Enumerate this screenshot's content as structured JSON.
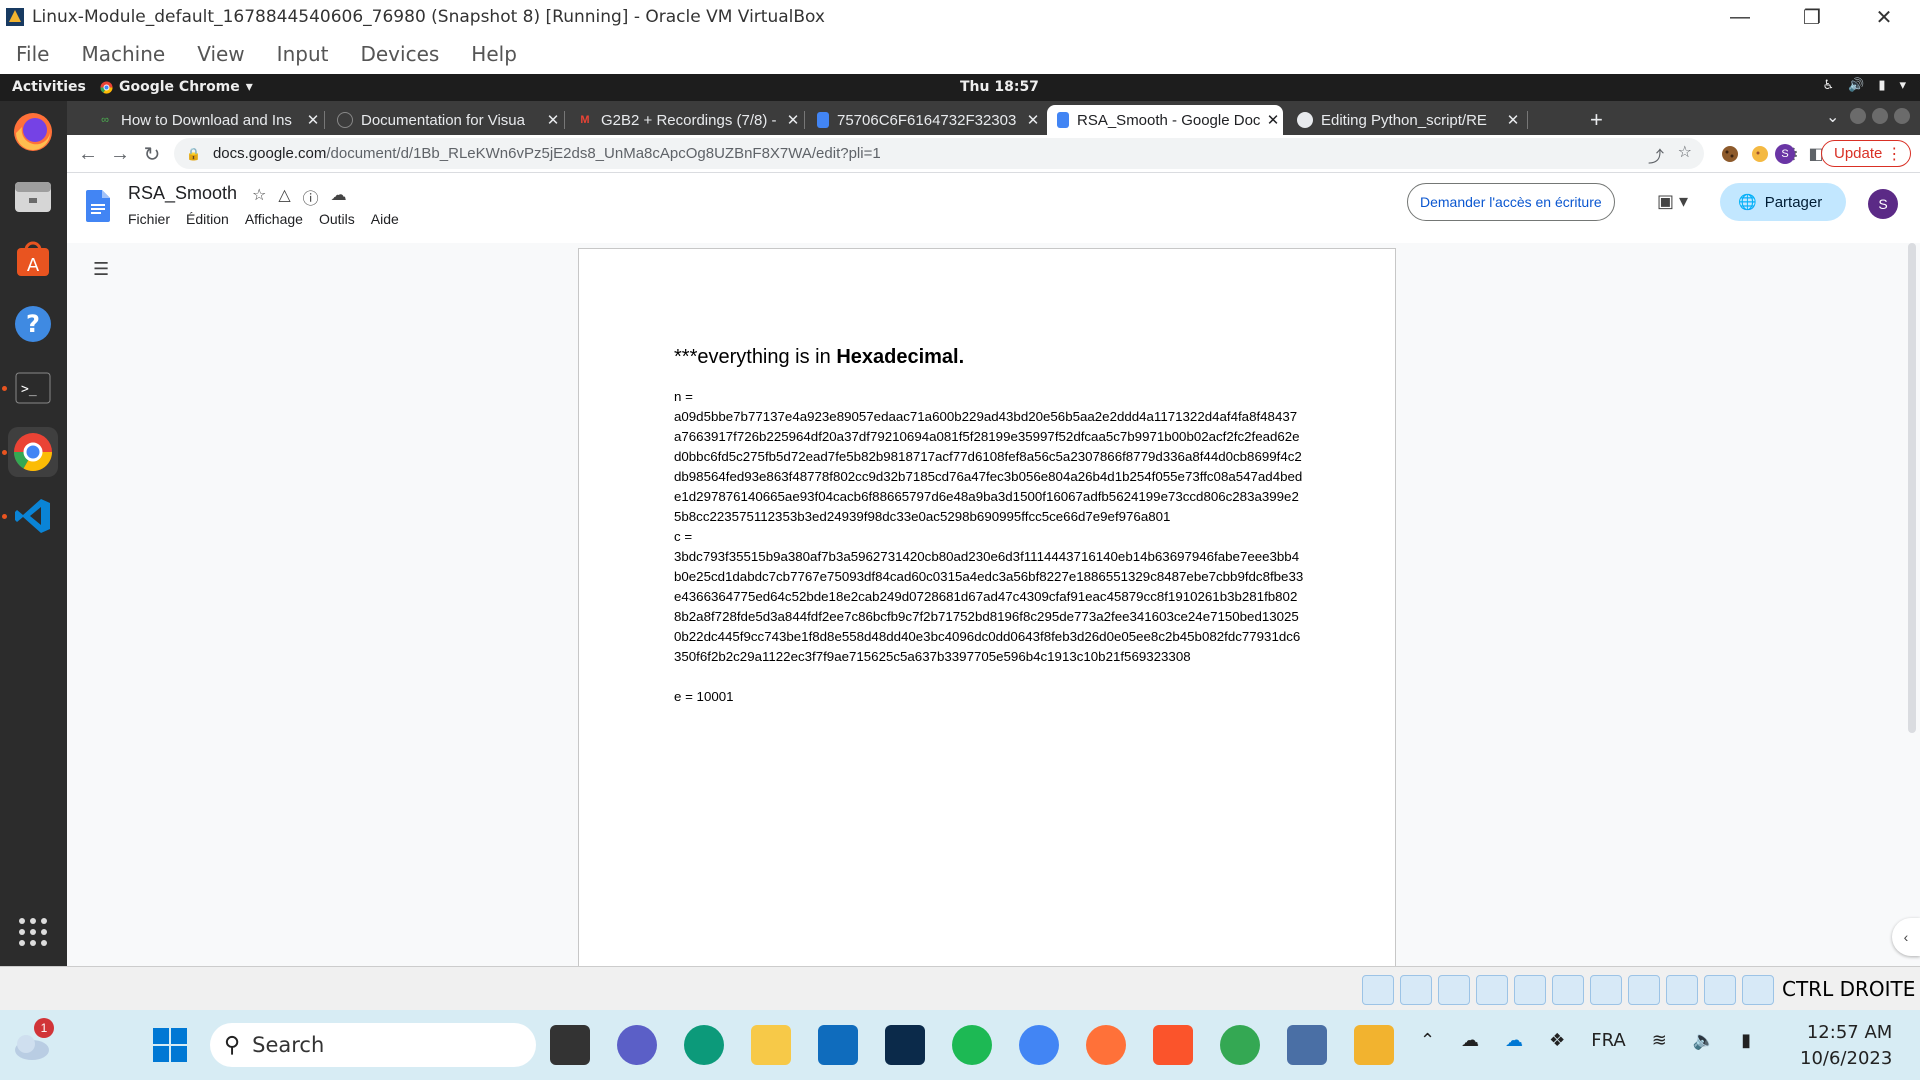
{
  "vbox": {
    "window_title": "Linux-Module_default_1678844540606_76980 (Snapshot 8) [Running] - Oracle VM VirtualBox",
    "menu": [
      "File",
      "Machine",
      "View",
      "Input",
      "Devices",
      "Help"
    ],
    "host_key": "CTRL DROITE"
  },
  "ubuntu_topbar": {
    "activities": "Activities",
    "app_name": "Google Chrome",
    "clock": "Thu 18:57"
  },
  "dock": {
    "items": [
      "firefox-icon",
      "files-icon",
      "app-center-icon",
      "help-icon",
      "terminal-icon",
      "chrome-icon",
      "vscode-icon",
      "app-grid-icon"
    ]
  },
  "chrome": {
    "tabs": [
      {
        "title": "How to Download and Ins",
        "icon": "tab-favicon"
      },
      {
        "title": "Documentation for Visua",
        "icon": "tab-favicon"
      },
      {
        "title": "G2B2 + Recordings (7/8) -",
        "icon": "gmail-icon"
      },
      {
        "title": "75706C6F6164732F32303",
        "icon": "docs-icon"
      },
      {
        "title": "RSA_Smooth - Google Doc",
        "icon": "docs-icon"
      },
      {
        "title": "Editing Python_script/RE",
        "icon": "github-icon"
      }
    ],
    "url_host": "docs.google.com",
    "url_path": "/document/d/1Bb_RLeKWn6vPz5jE2ds8_UnMa8cApcOg8UZBnF8X7WA/edit?pli=1",
    "update_label": "Update",
    "profile_initial": "S"
  },
  "docs": {
    "title": "RSA_Smooth",
    "menu": [
      "Fichier",
      "Édition",
      "Affichage",
      "Outils",
      "Aide"
    ],
    "request_edit_label": "Demander l'accès en écriture",
    "share_label": "Partager",
    "avatar_initial": "S"
  },
  "document": {
    "heading_prefix": "***everything is in ",
    "heading_bold": "Hexadecimal.",
    "n_label": "n =",
    "n_value": "a09d5bbe7b77137e4a923e89057edaac71a600b229ad43bd20e56b5aa2e2ddd4a1171322d4af4fa8f48437a7663917f726b225964df20a37df79210694a081f5f28199e35997f52dfcaa5c7b9971b00b02acf2fc2fead62ed0bbc6fd5c275fb5d72ead7fe5b82b9818717acf77d6108fef8a56c5a2307866f8779d336a8f44d0cb8699f4c2db98564fed93e863f48778f802cc9d32b7185cd76a47fec3b056e804a26b4d1b254f055e73ffc08a547ad4bede1d297876140665ae93f04cacb6f88665797d6e48a9ba3d1500f16067adfb5624199e73ccd806c283a399e25b8cc223575112353b3ed24939f98dc33e0ac5298b690995ffcc5ce66d7e9ef976a801",
    "c_label": "c =",
    "c_value": "3bdc793f35515b9a380af7b3a5962731420cb80ad230e6d3f1114443716140eb14b63697946fabe7eee3bb4b0e25cd1dabdc7cb7767e75093df84cad60c0315a4edc3a56bf8227e1886551329c8487ebe7cbb9fdc8fbe33e4366364775ed64c52bde18e2cab249d0728681d67ad47c4309cfaf91eac45879cc8f1910261b3b281fb8028b2a8f728fde5d3a844fdf2ee7c86bcfb9c7f2b71752bd8196f8c295de773a2fee341603ce24e7150bed130250b22dc445f9cc743be1f8d8e558d48dd40e3bc4096dc0dd0643f8feb3d26d0e05ee8c2b45b082fdc77931dc6350f6f2b2c29a1122ec3f7f9ae715625c5a637b3397705e596b4c1913c10b21f569323308",
    "e_line": "e = 10001"
  },
  "taskbar": {
    "search_label": "Search",
    "notification_count": "1",
    "language": "FRA",
    "time": "12:57 AM",
    "date": "10/6/2023"
  }
}
